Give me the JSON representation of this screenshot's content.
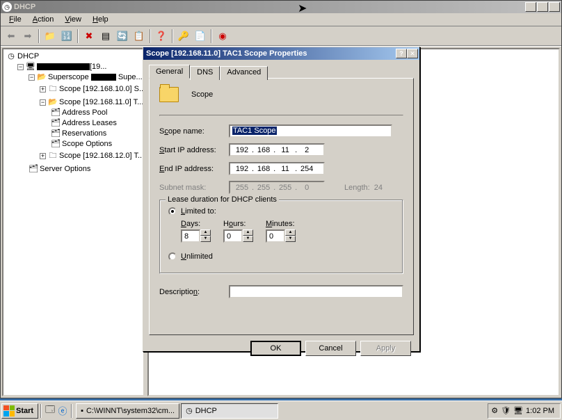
{
  "mainWindow": {
    "title": "DHCP",
    "menus": {
      "file": "File",
      "action": "Action",
      "view": "View",
      "help": "Help"
    }
  },
  "tree": {
    "root": "DHCP",
    "server": "[19...",
    "superscope": "Superscope ",
    "superscopeSuffix": " Supe...",
    "scope1": "Scope [192.168.10.0] S...",
    "scope2": "Scope [192.168.11.0] T...",
    "addressPool": "Address Pool",
    "addressLeases": "Address Leases",
    "reservations": "Reservations",
    "scopeOptions": "Scope Options",
    "scope3": "Scope [192.168.12.0] T...",
    "serverOptions": "Server Options"
  },
  "dialog": {
    "title": "Scope [192.168.11.0] TAC1 Scope Properties",
    "tabs": {
      "general": "General",
      "dns": "DNS",
      "advanced": "Advanced"
    },
    "headerLabel": "Scope",
    "labels": {
      "scopeName": "Scope name:",
      "startIp": "Start IP address:",
      "endIp": "End IP address:",
      "subnetMask": "Subnet mask:",
      "length": "Length:",
      "description": "Description:"
    },
    "values": {
      "scopeName": "TAC1 Scope",
      "startIp": [
        "192",
        "168",
        "11",
        "2"
      ],
      "endIp": [
        "192",
        "168",
        "11",
        "254"
      ],
      "subnetMask": [
        "255",
        "255",
        "255",
        "0"
      ],
      "length": "24",
      "description": ""
    },
    "lease": {
      "groupTitle": "Lease duration for DHCP clients",
      "limitedTo": "Limited to:",
      "unlimited": "Unlimited",
      "daysLabel": "Days:",
      "hoursLabel": "Hours:",
      "minutesLabel": "Minutes:",
      "days": "8",
      "hours": "0",
      "minutes": "0"
    },
    "buttons": {
      "ok": "OK",
      "cancel": "Cancel",
      "apply": "Apply"
    }
  },
  "taskbar": {
    "start": "Start",
    "task1": "C:\\WINNT\\system32\\cm...",
    "task2": "DHCP",
    "time": "1:02 PM"
  }
}
